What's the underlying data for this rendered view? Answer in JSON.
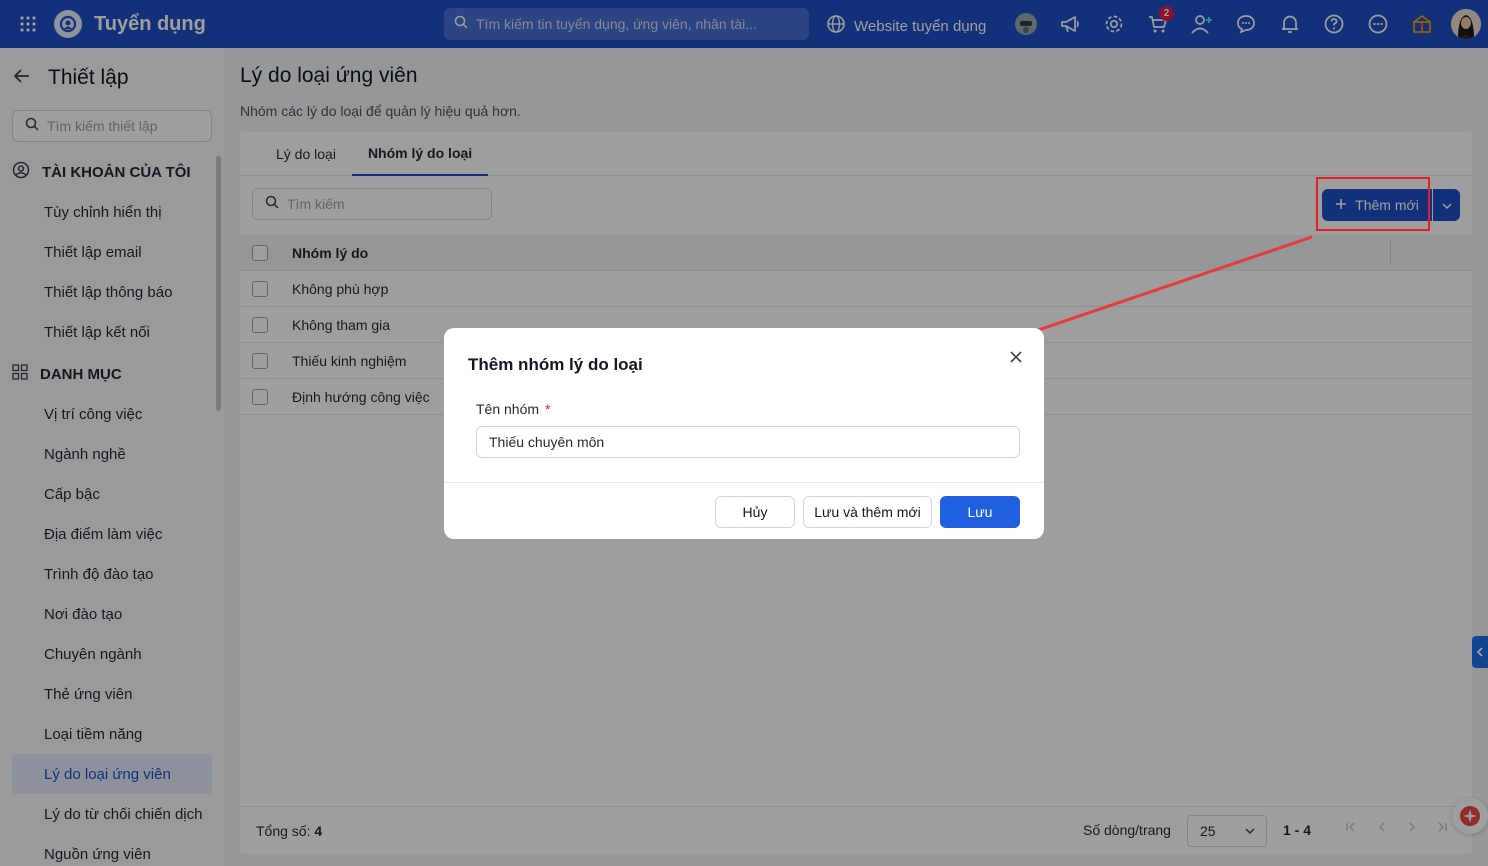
{
  "topbar": {
    "app_title": "Tuyển dụng",
    "search_placeholder": "Tìm kiếm tin tuyển dụng, ứng viên, nhân tài...",
    "website_link": "Website tuyển dụng",
    "cart_badge": "2",
    "icons": [
      "apps-grid-icon",
      "app-logo-icon",
      "search-icon",
      "globe-icon",
      "bot-avatar-icon",
      "megaphone-icon",
      "settings-icon",
      "cart-icon",
      "add-user-icon",
      "chat-icon",
      "bell-icon",
      "help-icon",
      "more-icon",
      "gift-icon",
      "user-avatar"
    ]
  },
  "sidebar": {
    "title": "Thiết lập",
    "search_placeholder": "Tìm kiếm thiết lập",
    "sections": [
      {
        "label": "TÀI KHOẢN CỦA TÔI",
        "items": [
          "Tùy chỉnh hiển thị",
          "Thiết lập email",
          "Thiết lập thông báo",
          "Thiết lập kết nối"
        ]
      },
      {
        "label": "DANH MỤC",
        "items": [
          "Vị trí công việc",
          "Ngành nghề",
          "Cấp bậc",
          "Địa điểm làm việc",
          "Trình độ đào tạo",
          "Nơi đào tạo",
          "Chuyên ngành",
          "Thẻ ứng viên",
          "Loại tiềm năng",
          "Lý do loại ứng viên",
          "Lý do từ chối chiến dịch",
          "Nguồn ứng viên"
        ]
      }
    ],
    "active_item": "Lý do loại ứng viên"
  },
  "main": {
    "title": "Lý do loại ứng viên",
    "description": "Nhóm các lý do loại để quản lý hiệu quả hơn.",
    "tabs": [
      {
        "label": "Lý do loại",
        "active": false
      },
      {
        "label": "Nhóm lý do loại",
        "active": true
      }
    ],
    "search_placeholder": "Tìm kiếm",
    "add_button": "Thêm mới",
    "table": {
      "header": "Nhóm lý do",
      "rows": [
        "Không phù hợp",
        "Không tham gia",
        "Thiếu kinh nghiệm",
        "Định hướng công việc"
      ]
    },
    "footer": {
      "total_label": "Tổng số:",
      "total_value": "4",
      "rows_per_page_label": "Số dòng/trang",
      "rows_per_page": "25",
      "range": "1 - 4"
    }
  },
  "modal": {
    "title": "Thêm nhóm lý do loại",
    "field_label": "Tên nhóm",
    "required_mark": "*",
    "field_value": "Thiếu chuyên môn",
    "cancel": "Hủy",
    "save_and_new": "Lưu và thêm mới",
    "save": "Lưu"
  },
  "colors": {
    "brand": "#1f4fc7",
    "primary_button": "#1f5fe0",
    "annotation_red": "#e11d2a",
    "active_item_bg": "#e3eafc"
  }
}
